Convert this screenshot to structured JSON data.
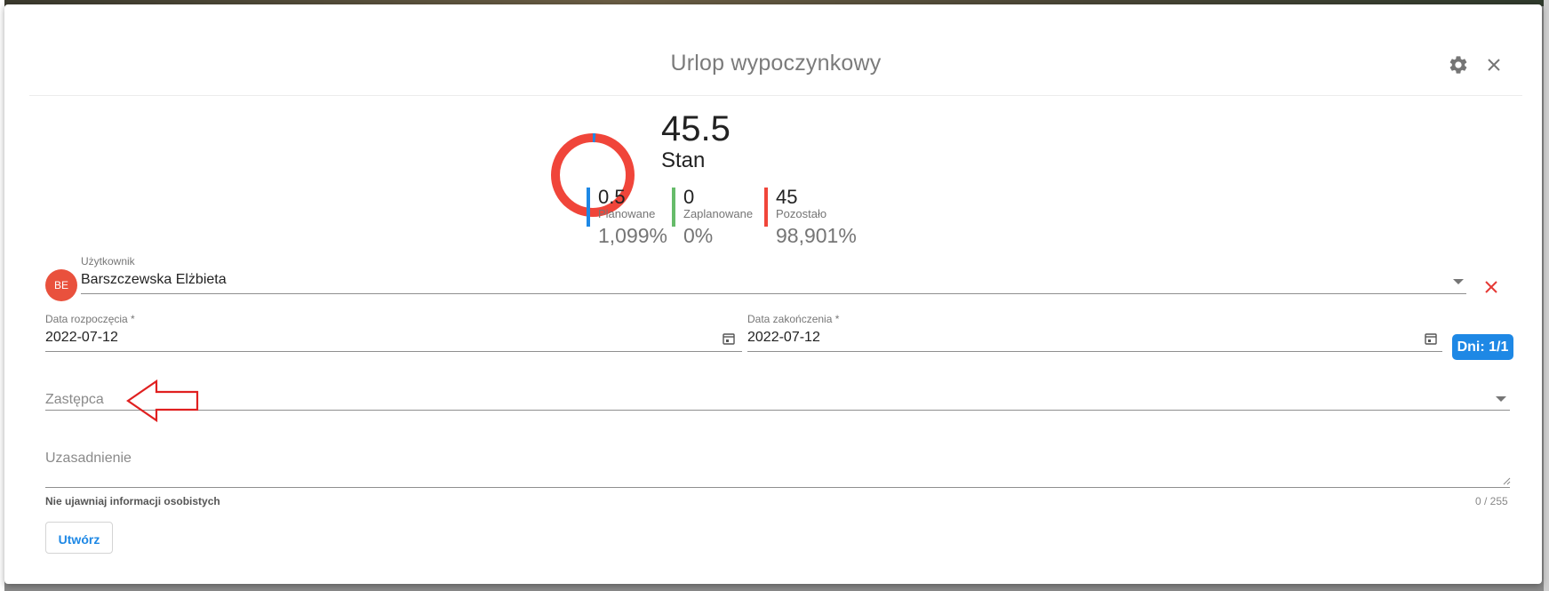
{
  "dialog": {
    "title": "Urlop wypoczynkowy",
    "settings_icon": "gear-icon",
    "close_icon": "close-icon"
  },
  "summary": {
    "total": "45.5",
    "total_label": "Stan",
    "stats": [
      {
        "value": "0.5",
        "label": "Planowane",
        "percent": "1,099%",
        "color": "#1e88e5"
      },
      {
        "value": "0",
        "label": "Zaplanowane",
        "percent": "0%",
        "color": "#66bb6a"
      },
      {
        "value": "45",
        "label": "Pozostało",
        "percent": "98,901%",
        "color": "#f0453a"
      }
    ],
    "donut_fractions": {
      "planned": 0.011,
      "scheduled": 0.0,
      "remaining": 0.989
    }
  },
  "form": {
    "user": {
      "label": "Użytkownik",
      "value": "Barszczewska Elżbieta",
      "avatar_initials": "BE",
      "avatar_color": "#e9513d"
    },
    "start_date": {
      "label": "Data rozpoczęcia *",
      "value": "2022-07-12"
    },
    "end_date": {
      "label": "Data zakończenia *",
      "value": "2022-07-12"
    },
    "days_badge": "Dni: 1/1",
    "substitute": {
      "placeholder": "Zastępca"
    },
    "justification": {
      "placeholder": "Uzasadnienie",
      "hint": "Nie ujawniaj informacji osobistych",
      "counter": "0 / 255"
    },
    "create_button": "Utwórz"
  },
  "colors": {
    "accent": "#1e88e5",
    "danger": "#e53935",
    "annotation_arrow": "#e02020"
  }
}
